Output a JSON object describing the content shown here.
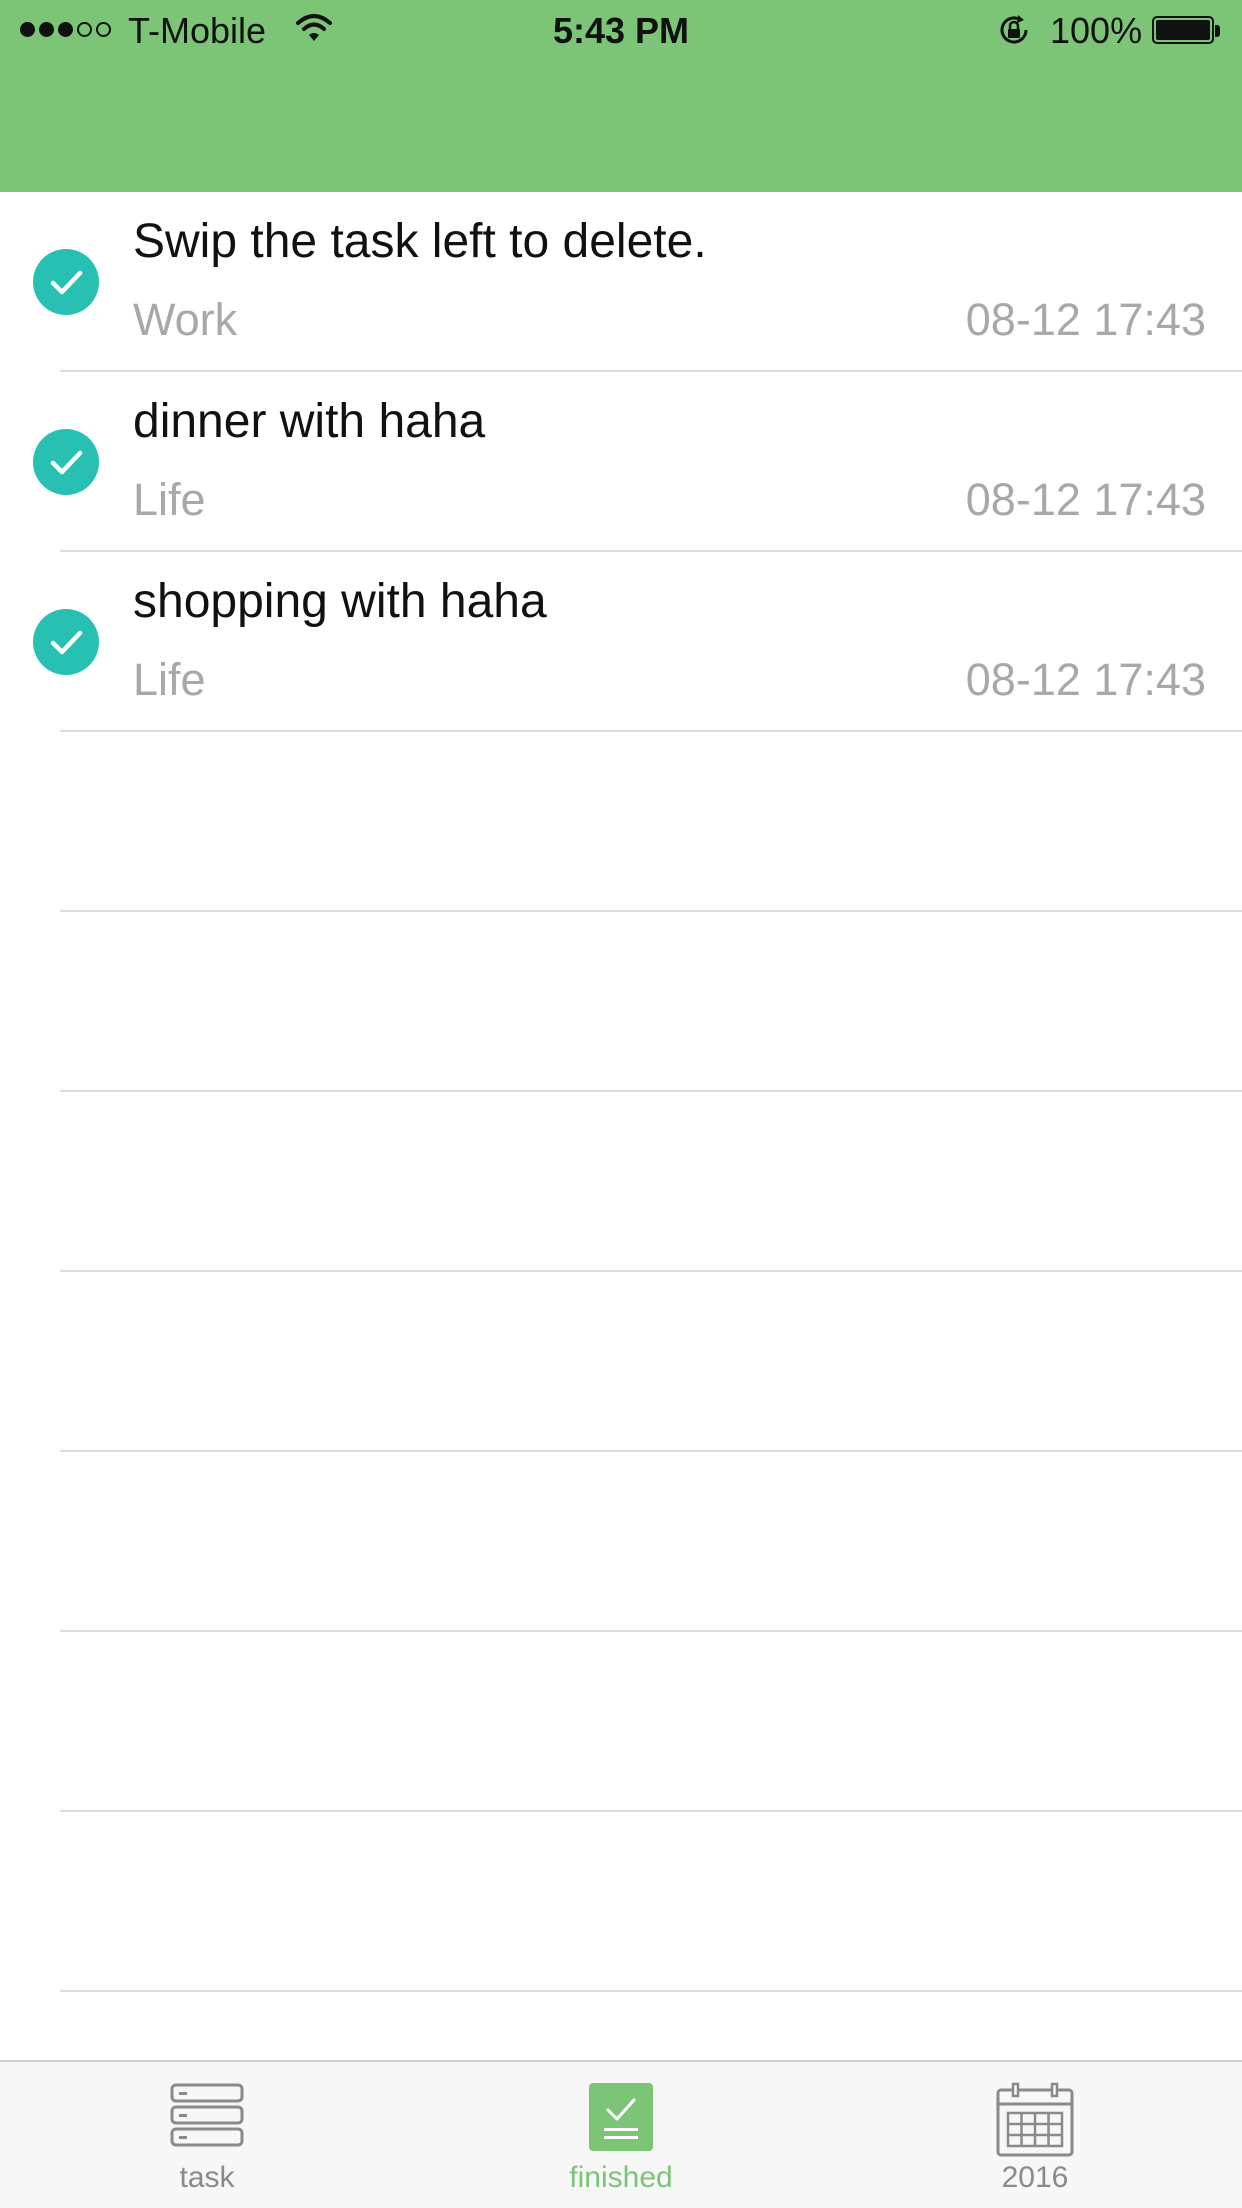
{
  "status_bar": {
    "carrier": "T-Mobile",
    "time": "5:43 PM",
    "battery": "100%",
    "signal_bars_filled": 3,
    "signal_bars_total": 5
  },
  "colors": {
    "header": "#7cc576",
    "check": "#27c0b2",
    "active_tab": "#7cc576"
  },
  "tasks": [
    {
      "title": "Swip the task left to delete.",
      "category": "Work",
      "time": "08-12 17:43",
      "completed": true
    },
    {
      "title": "dinner with haha",
      "category": "Life",
      "time": "08-12 17:43",
      "completed": true
    },
    {
      "title": "shopping with haha",
      "category": "Life",
      "time": "08-12 17:43",
      "completed": true
    }
  ],
  "tabs": [
    {
      "label": "task",
      "icon": "list-stack-icon",
      "active": false
    },
    {
      "label": "finished",
      "icon": "finished-check-icon",
      "active": true
    },
    {
      "label": "2016",
      "icon": "calendar-icon",
      "active": false
    }
  ]
}
